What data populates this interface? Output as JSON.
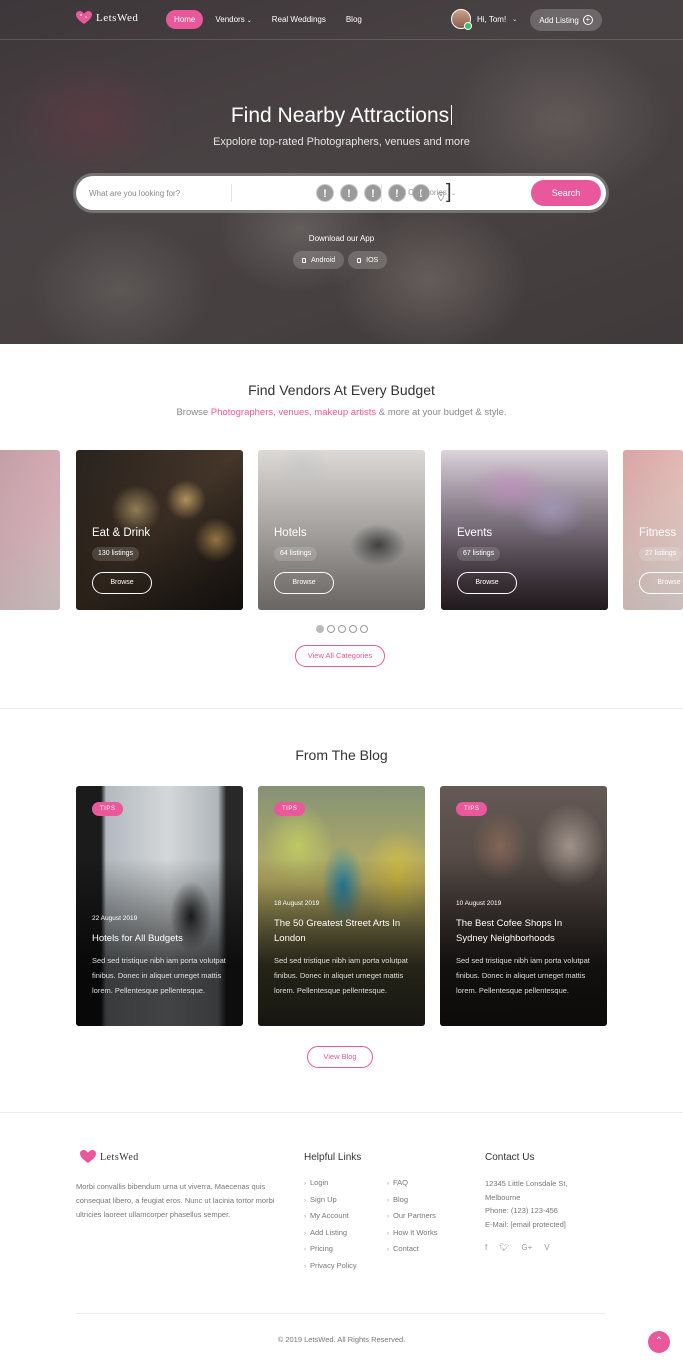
{
  "brand": {
    "name": "LetsWed"
  },
  "nav": {
    "items": [
      {
        "label": "Home",
        "active": true
      },
      {
        "label": "Vendors",
        "dropdown": true
      },
      {
        "label": "Real Weddings"
      },
      {
        "label": "Blog"
      }
    ],
    "user_greeting": "Hi, Tom!",
    "add_listing": "Add Listing"
  },
  "hero": {
    "title": "Find Nearby Attractions",
    "subtitle": "Expolore top-rated Photographers, venues and more",
    "search_placeholder": "What are you looking for?",
    "category_select": "All Categories",
    "search_button": "Search",
    "download_title": "Download our App",
    "app_android": "Android",
    "app_ios": "IOS"
  },
  "vendors": {
    "title": "Find Vendors At Every Budget",
    "subtitle_pre": "Browse ",
    "subtitle_links": "Photographers, venues, makeup artists",
    "subtitle_post": " & more at your budget & style.",
    "cards": [
      {
        "name": "Eat & Drink",
        "count": "130 listings",
        "browse": "Browse"
      },
      {
        "name": "Hotels",
        "count": "64 listings",
        "browse": "Browse"
      },
      {
        "name": "Events",
        "count": "67 listings",
        "browse": "Browse"
      },
      {
        "name": "Fitness",
        "count": "27 listings",
        "browse": "Browse"
      }
    ],
    "view_all": "View All Categories"
  },
  "blog": {
    "title": "From The Blog",
    "posts": [
      {
        "tag": "TIPS",
        "date": "22 August 2019",
        "title": "Hotels for All Budgets",
        "excerpt": "Sed sed tristique nibh iam porta volutpat finibus. Donec in aliquet urneget mattis lorem. Pellentesque pellentesque."
      },
      {
        "tag": "TIPS",
        "date": "18 August 2019",
        "title": "The 50 Greatest Street Arts In London",
        "excerpt": "Sed sed tristique nibh iam porta volutpat finibus. Donec in aliquet urneget mattis lorem. Pellentesque pellentesque."
      },
      {
        "tag": "TIPS",
        "date": "10 August 2019",
        "title": "The Best Cofee Shops In Sydney Neighborhoods",
        "excerpt": "Sed sed tristique nibh iam porta volutpat finibus. Donec in aliquet urneget mattis lorem. Pellentesque pellentesque."
      }
    ],
    "view_blog": "View Blog"
  },
  "footer": {
    "about": "Morbi convallis bibendum urna ut viverra. Maecenas quis consequat libero, a feugiat eros. Nunc ut lacinia tortor morbi ultricies laoreet ullamcorper phasellus semper.",
    "helpful_links_title": "Helpful Links",
    "links_col1": [
      "Login",
      "Sign Up",
      "My Account",
      "Add Listing",
      "Pricing",
      "Privacy Policy"
    ],
    "links_col2": [
      "FAQ",
      "Blog",
      "Our Partners",
      "How It Works",
      "Contact"
    ],
    "contact_title": "Contact Us",
    "address_line1": "12345 Little Lonsdale St,",
    "address_line2": "Melbourne",
    "phone": "Phone: (123) 123-456",
    "email": "E-Mail: [email protected]",
    "copyright": "© 2019 LetsWed. All Rights Reserved."
  },
  "colors": {
    "accent": "#e8589a"
  }
}
